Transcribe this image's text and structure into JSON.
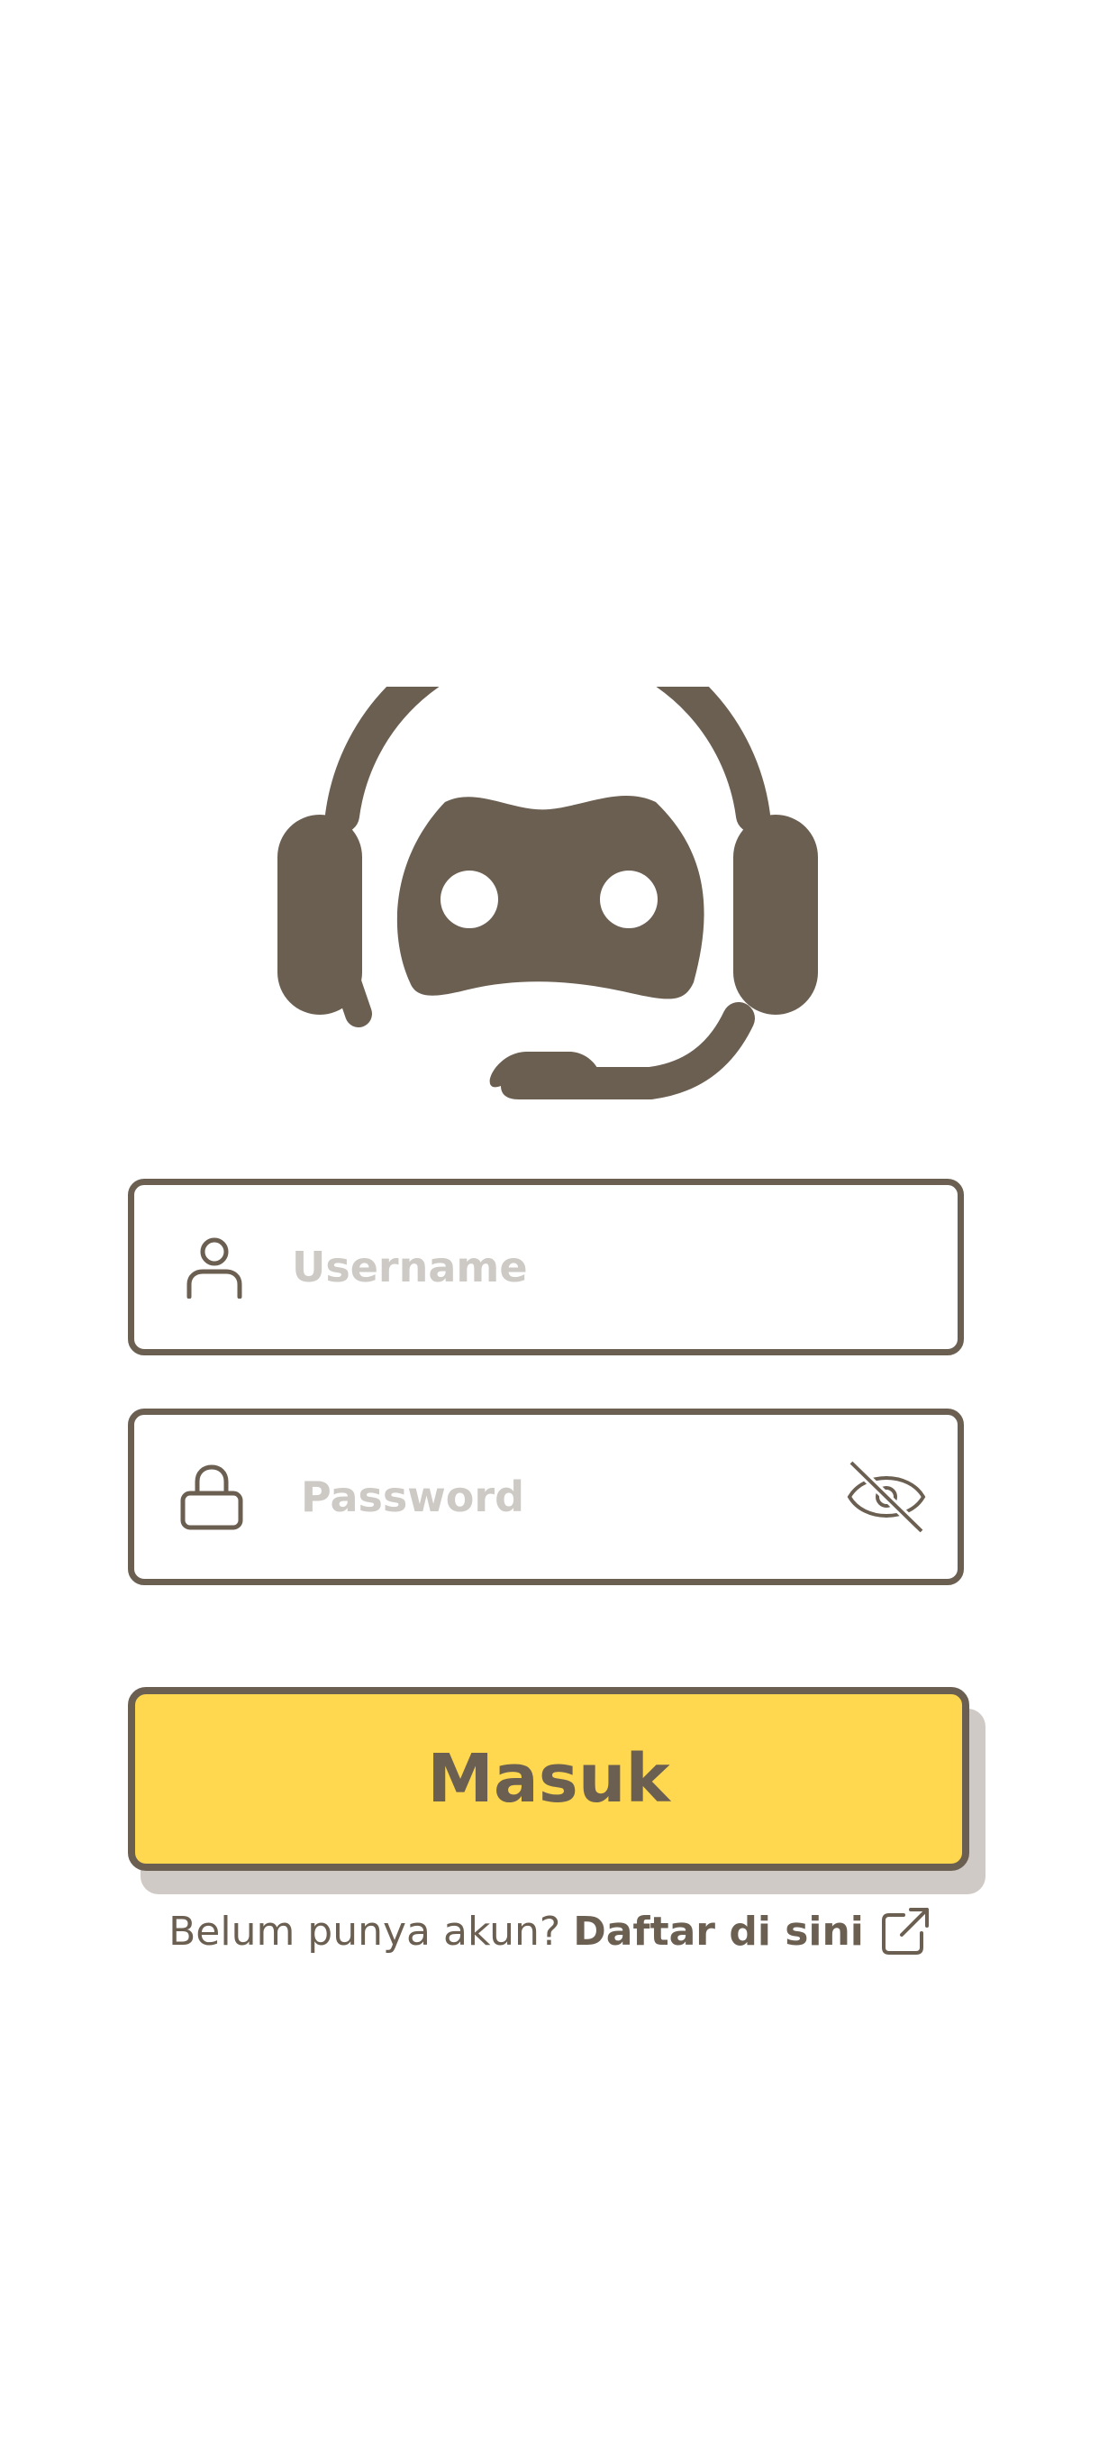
{
  "login": {
    "logo_icon": "support-robot-headset-icon",
    "username": {
      "icon": "user-icon",
      "placeholder": "Username",
      "value": ""
    },
    "password": {
      "icon": "lock-icon",
      "placeholder": "Password",
      "value": "",
      "toggle_icon": "eye-off-icon"
    },
    "submit_label": "Masuk",
    "signup_prompt": "Belum punya akun?",
    "signup_link": "Daftar di sini",
    "signup_icon": "external-link-icon"
  },
  "colors": {
    "primary": "#6b5f52",
    "accent": "#ffd84f",
    "placeholder": "#cdc9c4",
    "shadow": "#cfcac5",
    "background": "#ffffff"
  }
}
